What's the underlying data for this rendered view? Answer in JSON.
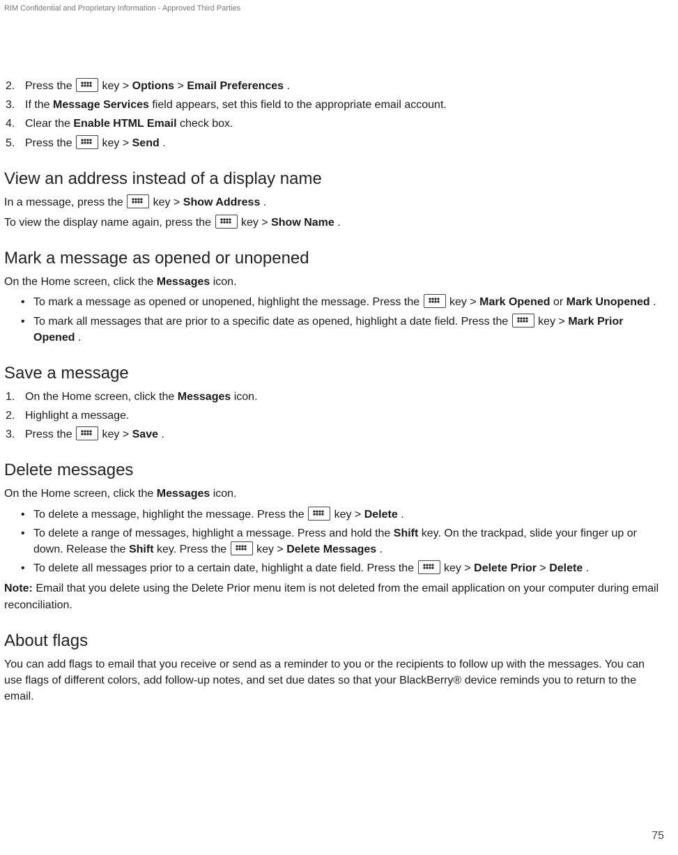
{
  "header": {
    "confidential": "RIM Confidential and Proprietary Information - Approved Third Parties"
  },
  "pageNumber": "75",
  "icons": {
    "menuKeyAlt": "menu key"
  },
  "steps1": {
    "n2": "2.",
    "n3": "3.",
    "n4": "4.",
    "n5": "5.",
    "t2_a": "Press the ",
    "t2_b": " key > ",
    "t2_opt": "Options",
    "t2_gt": " > ",
    "t2_ep": "Email Preferences",
    "t2_end": ".",
    "t3_a": "If the ",
    "t3_ms": "Message Services",
    "t3_b": " field appears, set this field to the appropriate email account.",
    "t4_a": "Clear the ",
    "t4_en": "Enable HTML Email",
    "t4_b": " check box.",
    "t5_a": "Press the ",
    "t5_b": " key > ",
    "t5_send": "Send",
    "t5_end": "."
  },
  "secAddr": {
    "heading": "View an address instead of a display name",
    "p1_a": "In a message, press the ",
    "p1_b": " key > ",
    "p1_sa": "Show Address",
    "p1_end": ".",
    "p2_a": "To view the display name again, press the ",
    "p2_b": " key > ",
    "p2_sn": "Show Name",
    "p2_end": "."
  },
  "secMark": {
    "heading": "Mark a message as opened or unopened",
    "intro_a": "On the Home screen, click the ",
    "intro_m": "Messages",
    "intro_b": " icon.",
    "b1_a": "To mark a message as opened or unopened, highlight the message. Press the ",
    "b1_b": " key > ",
    "b1_mo": "Mark Opened",
    "b1_or": " or ",
    "b1_mu": "Mark Unopened",
    "b1_end": ".",
    "b2_a": "To mark all messages that are prior to a specific date as opened, highlight a date field. Press the ",
    "b2_b": " key > ",
    "b2_mp": "Mark Prior Opened",
    "b2_end": "."
  },
  "secSave": {
    "heading": "Save a message",
    "n1": "1.",
    "n2": "2.",
    "n3": "3.",
    "t1_a": "On the Home screen, click the ",
    "t1_m": "Messages",
    "t1_b": " icon.",
    "t2": "Highlight a message.",
    "t3_a": "Press the ",
    "t3_b": " key > ",
    "t3_save": "Save",
    "t3_end": "."
  },
  "secDel": {
    "heading": "Delete messages",
    "intro_a": "On the Home screen, click the ",
    "intro_m": "Messages",
    "intro_b": " icon.",
    "b1_a": "To delete a message, highlight the message. Press the ",
    "b1_b": " key > ",
    "b1_d": "Delete",
    "b1_end": ".",
    "b2_a": "To delete a range of messages, highlight a message. Press and hold the ",
    "b2_shift1": "Shift",
    "b2_b": " key. On the trackpad, slide your finger up or down. Release the ",
    "b2_shift2": "Shift",
    "b2_c": " key. Press the ",
    "b2_d": " key > ",
    "b2_dm": "Delete Messages",
    "b2_end": ".",
    "b3_a": "To delete all messages prior to a certain date, highlight a date field. Press the ",
    "b3_b": " key > ",
    "b3_dp": "Delete Prior",
    "b3_gt": " > ",
    "b3_d": "Delete",
    "b3_end": ".",
    "note_label": "Note:",
    "note_body": " Email that you delete using the Delete Prior menu item is not deleted from the email application on your computer during email reconciliation."
  },
  "secFlags": {
    "heading": "About flags",
    "p": "You can add flags to email that you receive or send as a reminder to you or the recipients to follow up with the messages. You can use flags of different colors, add follow-up notes, and set due dates so that your BlackBerry® device reminds you to return to the email."
  }
}
